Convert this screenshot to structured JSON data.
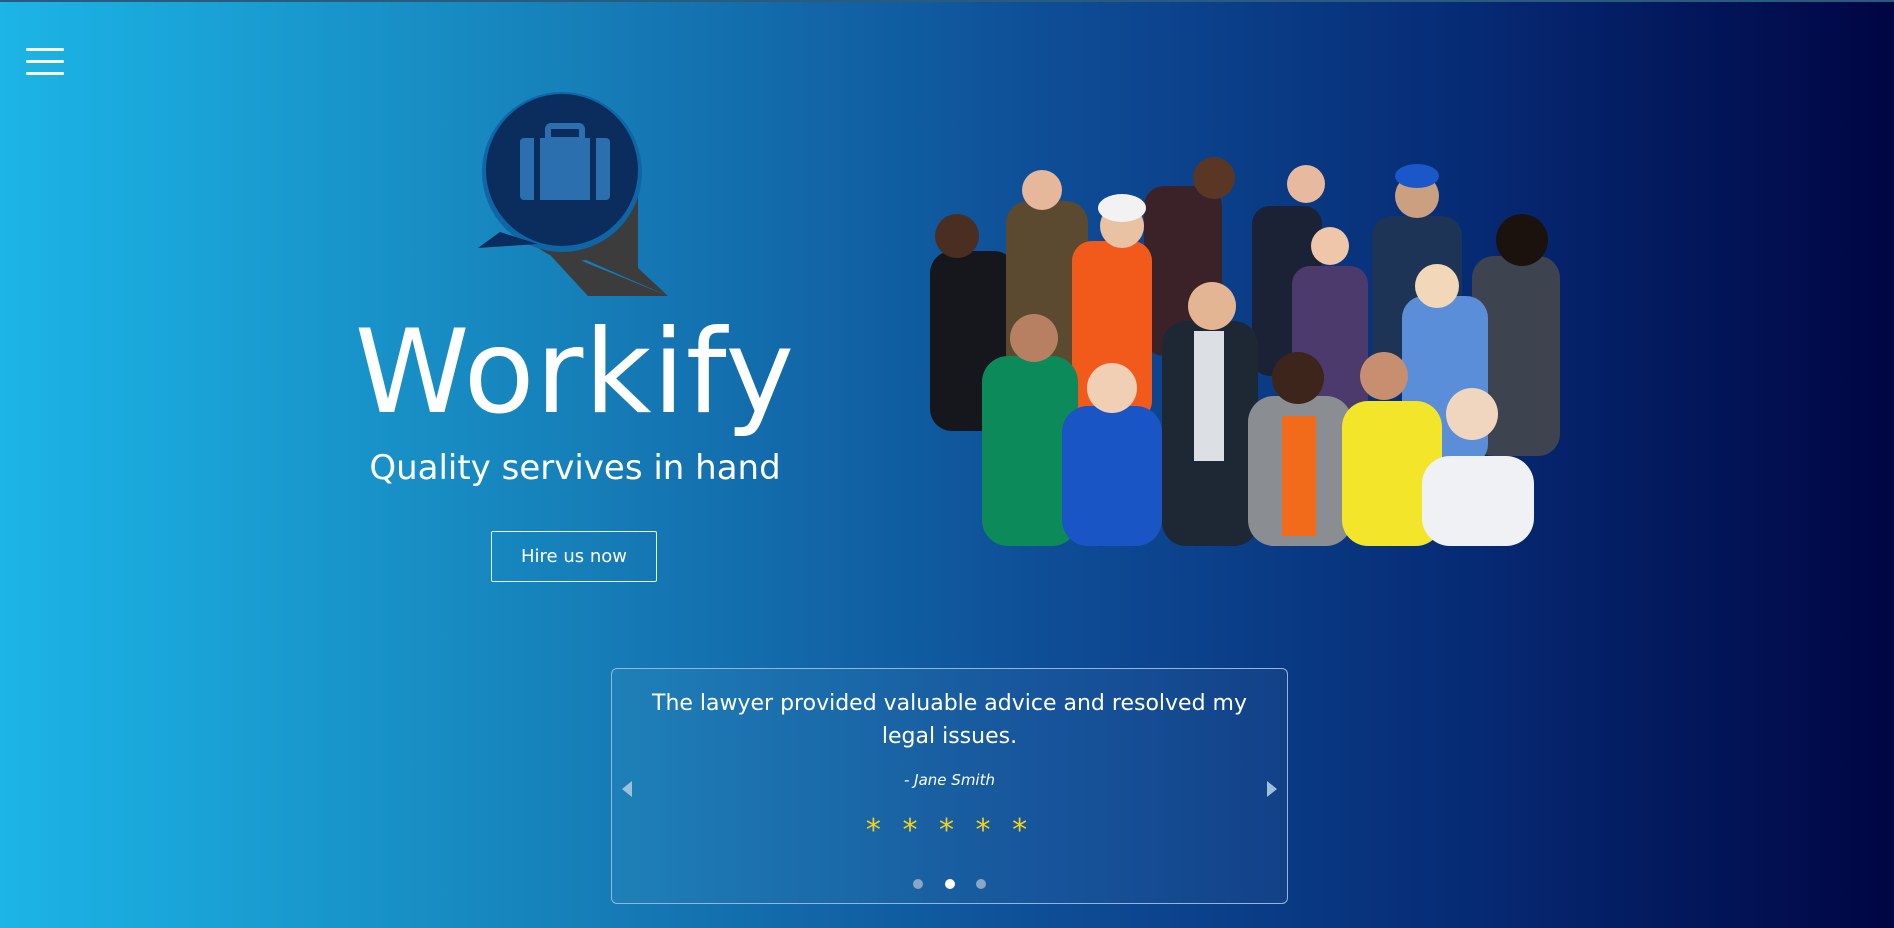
{
  "header": {
    "menu_icon": "hamburger-menu-icon"
  },
  "hero": {
    "logo_icon": "briefcase-chat-icon",
    "brand": "Workify",
    "tagline": "Quality servives in hand",
    "cta_label": "Hire us now",
    "image_icon": "group-of-professionals-photo"
  },
  "testimonial": {
    "quote": "The lawyer provided valuable advice and resolved my legal issues.",
    "author": "- Jane Smith",
    "stars": "* * * * *",
    "rating": 5,
    "active_slide": 2,
    "slide_count": 3,
    "prev_icon": "chevron-left-icon",
    "next_icon": "chevron-right-icon"
  },
  "colors": {
    "gradient_start": "#1cb5e6",
    "gradient_end": "#000543",
    "star": "#f2d21b",
    "logo_bubble": "#0b2d5e",
    "logo_bubble_back": "#3c3c3c"
  }
}
